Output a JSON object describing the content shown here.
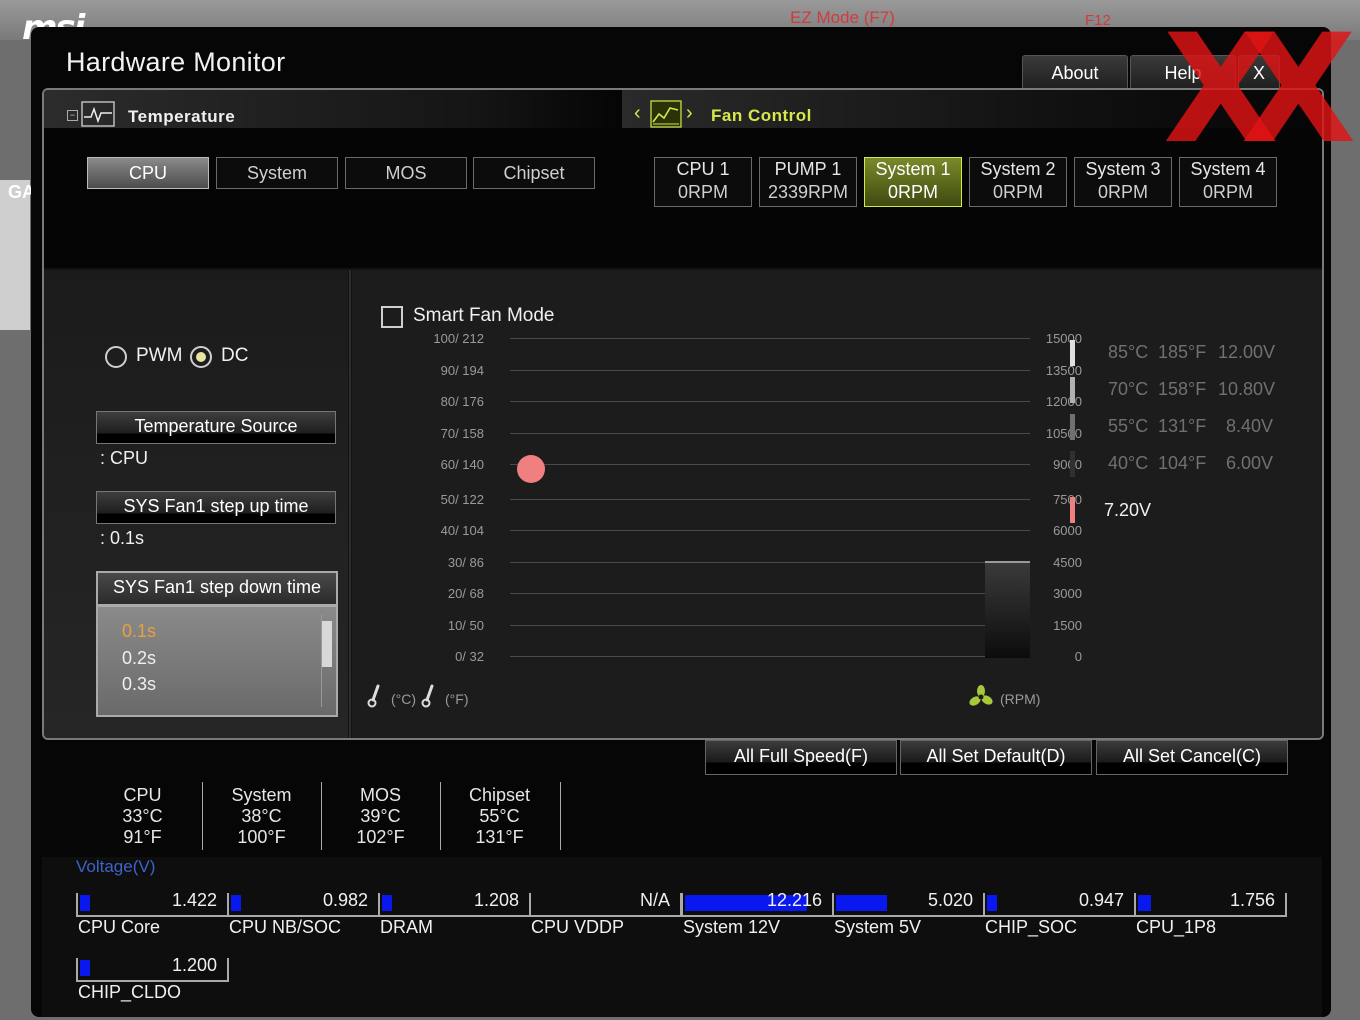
{
  "background": {
    "logo": "msi",
    "ez_mode": "EZ Mode (F7)",
    "f12": "F12",
    "left_label": "GA"
  },
  "window": {
    "title": "Hardware Monitor",
    "about": "About",
    "help": "Help",
    "close": "X",
    "watermark": "XX"
  },
  "temperature_header": {
    "title": "Temperature"
  },
  "fan_header": {
    "title": "Fan Control",
    "prev": "‹",
    "next": "›"
  },
  "temp_tabs": [
    {
      "label": "CPU",
      "active": true
    },
    {
      "label": "System",
      "active": false
    },
    {
      "label": "MOS",
      "active": false
    },
    {
      "label": "Chipset",
      "active": false
    }
  ],
  "fan_tabs": [
    {
      "name": "CPU 1",
      "rpm": "0RPM",
      "active": false
    },
    {
      "name": "PUMP 1",
      "rpm": "2339RPM",
      "active": false
    },
    {
      "name": "System 1",
      "rpm": "0RPM",
      "active": true
    },
    {
      "name": "System 2",
      "rpm": "0RPM",
      "active": false
    },
    {
      "name": "System 3",
      "rpm": "0RPM",
      "active": false
    },
    {
      "name": "System 4",
      "rpm": "0RPM",
      "active": false
    }
  ],
  "mode": {
    "pwm": "PWM",
    "dc": "DC",
    "selected": "DC"
  },
  "temp_source": {
    "button": "Temperature Source",
    "value": ": CPU"
  },
  "step_up": {
    "button": "SYS Fan1 step up time",
    "value": ": 0.1s"
  },
  "step_down": {
    "button": "SYS Fan1 step down time",
    "options": [
      "0.1s",
      "0.2s",
      "0.3s"
    ],
    "selected": "0.1s"
  },
  "smart_fan": {
    "label": "Smart Fan Mode",
    "checked": false
  },
  "graph": {
    "left_ticks": [
      "100/ 212",
      "90/ 194",
      "80/ 176",
      "70/ 158",
      "60/ 140",
      "50/ 122",
      "40/ 104",
      "30/  86",
      "20/  68",
      "10/  50",
      "0/  32"
    ],
    "right_ticks": [
      "15000",
      "13500",
      "12000",
      "10500",
      "9000",
      "7500",
      "6000",
      "4500",
      "3000",
      "1500",
      "0"
    ],
    "x_unit_c": "(°C)",
    "x_unit_f": "(°F)",
    "rpm_unit": "(RPM)",
    "point_temp_c": 58,
    "rpm_bar_value": 4500
  },
  "voltage_scale": [
    {
      "c": "85°C",
      "f": "185°F",
      "v": "12.00V",
      "color": "#e0e0e0"
    },
    {
      "c": "70°C",
      "f": "158°F",
      "v": "10.80V",
      "color": "#b0b0b0"
    },
    {
      "c": "55°C",
      "f": "131°F",
      "v": "8.40V",
      "color": "#707070"
    },
    {
      "c": "40°C",
      "f": "104°F",
      "v": "6.00V",
      "color": "#303030"
    }
  ],
  "current_voltage": {
    "value": "7.20V",
    "color": "#f08080"
  },
  "actions": {
    "full_speed": "All Full Speed(F)",
    "set_default": "All Set Default(D)",
    "set_cancel": "All Set Cancel(C)"
  },
  "temps": [
    {
      "name": "CPU",
      "c": "33°C",
      "f": "91°F"
    },
    {
      "name": "System",
      "c": "38°C",
      "f": "100°F"
    },
    {
      "name": "MOS",
      "c": "39°C",
      "f": "102°F"
    },
    {
      "name": "Chipset",
      "c": "55°C",
      "f": "131°F"
    }
  ],
  "voltage_label": "Voltage(V)",
  "voltages": [
    {
      "name": "CPU Core",
      "value": "1.422",
      "level": 0.08
    },
    {
      "name": "CPU NB/SOC",
      "value": "0.982",
      "level": 0.06
    },
    {
      "name": "DRAM",
      "value": "1.208",
      "level": 0.07
    },
    {
      "name": "CPU VDDP",
      "value": "N/A",
      "level": 0
    },
    {
      "name": "System 12V",
      "value": "12.216",
      "level": 0.95
    },
    {
      "name": "System 5V",
      "value": "5.020",
      "level": 0.4
    },
    {
      "name": "CHIP_SOC",
      "value": "0.947",
      "level": 0.06
    },
    {
      "name": "CPU_1P8",
      "value": "1.756",
      "level": 0.1
    },
    {
      "name": "CHIP_CLDO",
      "value": "1.200",
      "level": 0.07
    }
  ],
  "colors": {
    "accent_green": "#d6e84a",
    "volt_blue": "#0a18f0",
    "point": "#f08080"
  }
}
